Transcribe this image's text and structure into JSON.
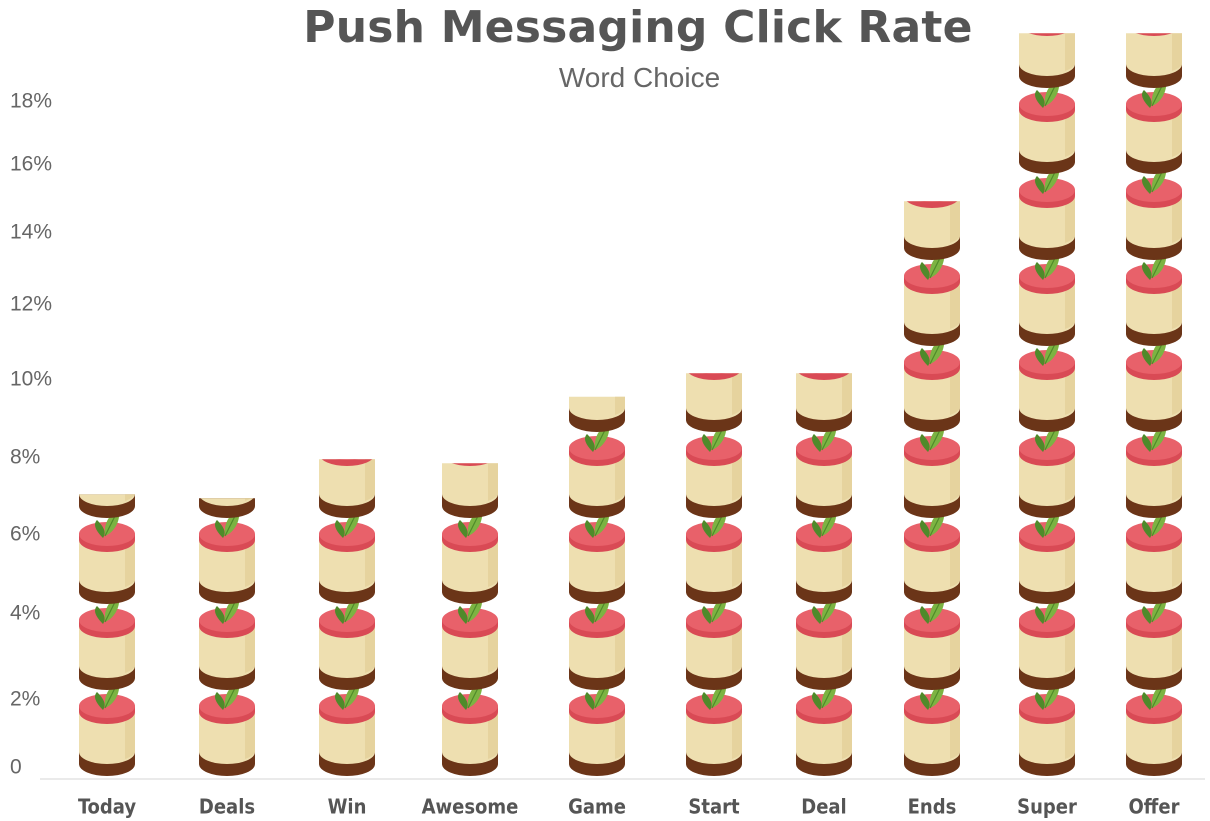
{
  "chart_data": {
    "type": "bar",
    "title": "Push Messaging Click Rate",
    "subtitle": "Word Choice",
    "xlabel": "",
    "ylabel": "",
    "categories": [
      "Today",
      "Deals",
      "Win",
      "Awesome",
      "Game",
      "Start",
      "Deal",
      "Ends",
      "Super",
      "Offer"
    ],
    "values": [
      6.4,
      6.3,
      7.3,
      7.2,
      8.7,
      9.3,
      9.3,
      13.3,
      17.2,
      17.2
    ],
    "ylim": [
      0,
      18
    ],
    "y_ticks": [
      "0",
      "2%",
      "4%",
      "6%",
      "8%",
      "10%",
      "12%",
      "14%",
      "16%",
      "18%"
    ],
    "grid": false,
    "legend": "none",
    "mark": "cheesecake-icon",
    "colors": {
      "top": "#e8616a",
      "top_rim": "#d94a55",
      "filling": "#eedfb0",
      "filling_shade": "#e3d09a",
      "crust": "#6b3518",
      "leaf": "#7cb342",
      "leaf_dark": "#4f8a2a",
      "axis_text": "#666666",
      "title_text": "#555555",
      "baseline": "#dddddd"
    }
  }
}
